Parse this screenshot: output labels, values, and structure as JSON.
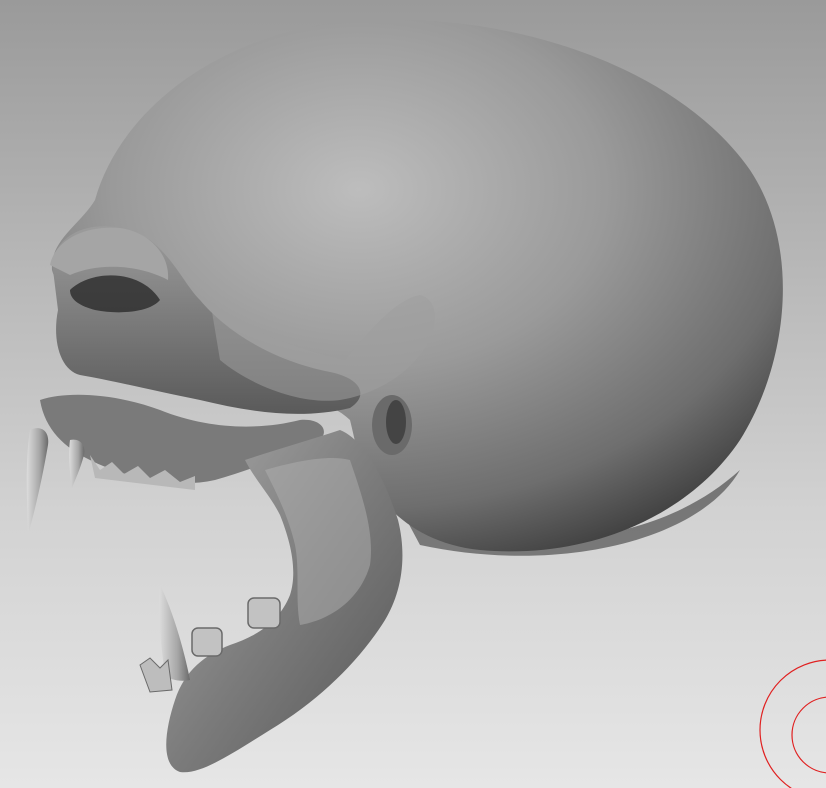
{
  "viewport": {
    "subject": "skull-sculpt",
    "background_top": "#9a9a9a",
    "background_bottom": "#e6e6e6",
    "material_base": "#8a8a8a",
    "material_highlight": "#c4c4c4",
    "material_shadow": "#3a3a3a"
  },
  "brush_cursor": {
    "icon": "brush-cursor-icon",
    "color": "#e02020"
  }
}
